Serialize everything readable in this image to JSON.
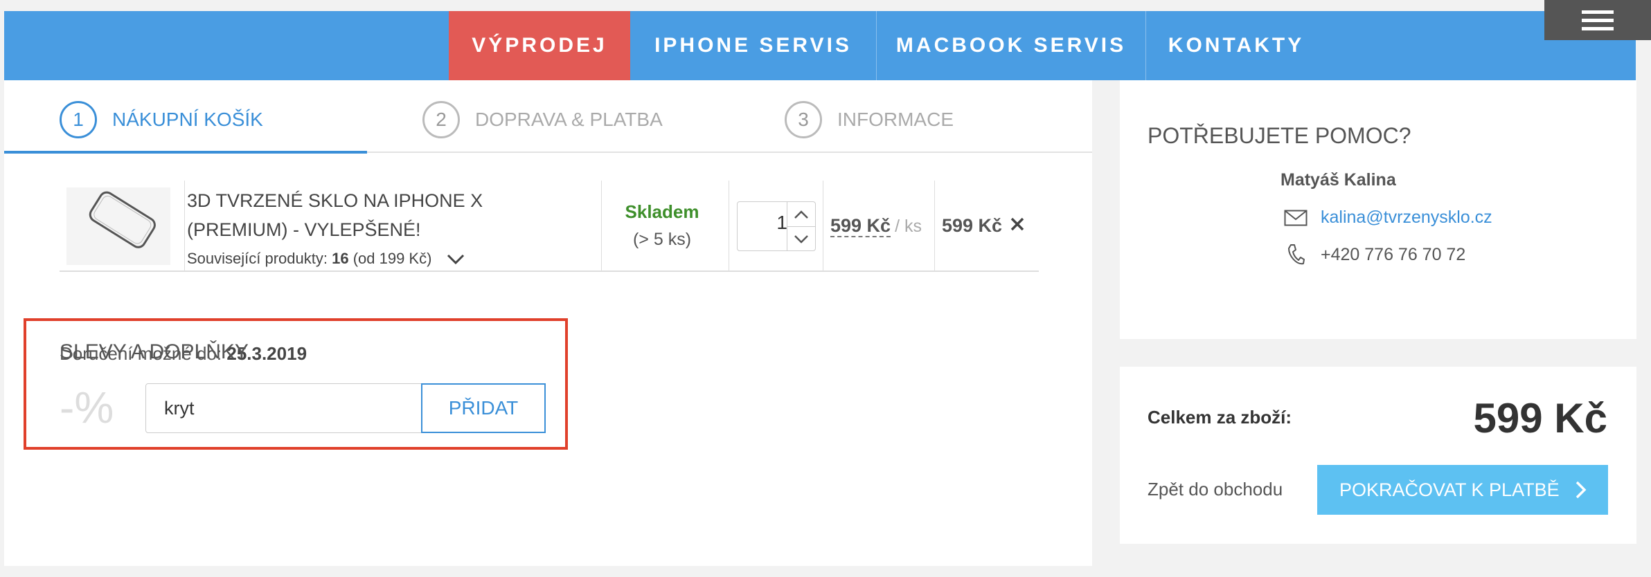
{
  "nav": {
    "items": [
      "VÝPRODEJ",
      "IPHONE SERVIS",
      "MACBOOK SERVIS",
      "KONTAKTY"
    ],
    "active_color": "#e25a55",
    "bar_color": "#4a9de3"
  },
  "menu_icon": "hamburger-icon",
  "steps": [
    {
      "num": "1",
      "label": "NÁKUPNÍ KOŠÍK",
      "active": true
    },
    {
      "num": "2",
      "label": "DOPRAVA & PLATBA",
      "active": false
    },
    {
      "num": "3",
      "label": "INFORMACE",
      "active": false
    }
  ],
  "cart": {
    "item": {
      "name": "3D TVRZENÉ SKLO NA IPHONE X (PREMIUM) - VYLEPŠENÉ!",
      "related_prefix": "Související produkty: ",
      "related_count": "16",
      "related_suffix": " (od 199 Kč)",
      "stock_status": "Skladem",
      "stock_detail": "(> 5 ks)",
      "quantity": "1",
      "unit_price": "599 Kč",
      "unit_label": "/ ks",
      "total": "599 Kč"
    },
    "delivery_label": "Doručení možné do: ",
    "delivery_date": "25.3.2019"
  },
  "discount": {
    "title": "SLEVY A DOPLŇKY",
    "percent_symbol": "-%",
    "code_value": "kryt",
    "add_label": "PŘIDAT",
    "highlight_color": "#e0402b"
  },
  "help": {
    "title": "POTŘEBUJETE POMOC?",
    "name": "Matyáš Kalina",
    "email": "kalina@tvrzenysklo.cz",
    "phone": "+420 776 76 70 72"
  },
  "summary": {
    "total_label": "Celkem za zboží:",
    "total_value": "599 Kč",
    "back_label": "Zpět do obchodu",
    "continue_label": "POKRAČOVAT K PLATBĚ",
    "continue_color": "#5dc1f2"
  }
}
